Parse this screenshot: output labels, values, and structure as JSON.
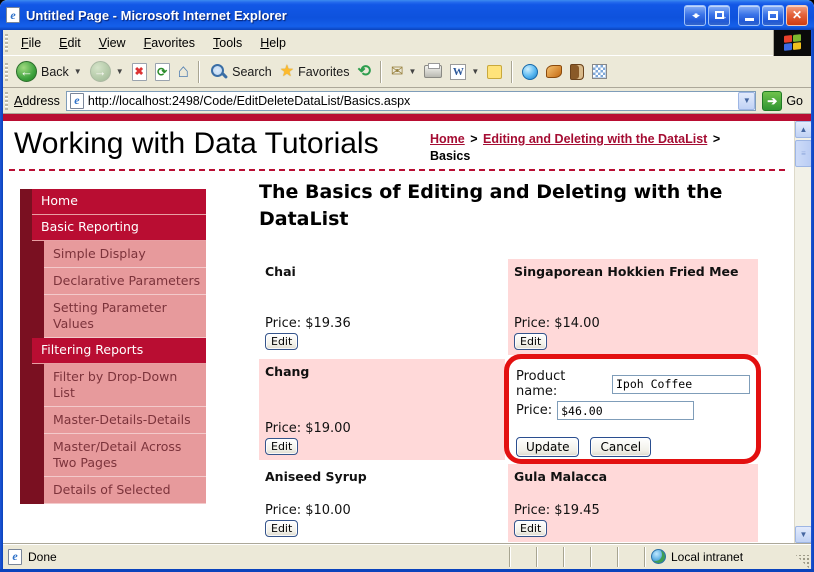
{
  "window": {
    "title": "Untitled Page - Microsoft Internet Explorer"
  },
  "menu": {
    "items": [
      "File",
      "Edit",
      "View",
      "Favorites",
      "Tools",
      "Help"
    ]
  },
  "toolbar": {
    "back_label": "Back",
    "search_label": "Search",
    "favorites_label": "Favorites",
    "icons": [
      "back",
      "forward",
      "stop",
      "refresh",
      "home",
      "search",
      "favorites",
      "history",
      "mail",
      "print",
      "edit-with-word",
      "notes",
      "messenger",
      "snagit",
      "research",
      "icq"
    ]
  },
  "address": {
    "label": "Address",
    "url": "http://localhost:2498/Code/EditDeleteDataList/Basics.aspx",
    "go_label": "Go"
  },
  "page": {
    "site_title": "Working with Data Tutorials",
    "breadcrumb": {
      "home": "Home",
      "separator": ">",
      "section": "Editing and Deleting with the DataList",
      "current": "Basics"
    }
  },
  "sidebar": {
    "items": [
      {
        "label": "Home",
        "level": 1
      },
      {
        "label": "Basic Reporting",
        "level": 1
      },
      {
        "label": "Simple Display",
        "level": 2
      },
      {
        "label": "Declarative Parameters",
        "level": 2
      },
      {
        "label": "Setting Parameter Values",
        "level": 2
      },
      {
        "label": "Filtering Reports",
        "level": 1
      },
      {
        "label": "Filter by Drop-Down List",
        "level": 2
      },
      {
        "label": "Master-Details-Details",
        "level": 2
      },
      {
        "label": "Master/Detail Across Two Pages",
        "level": 2
      },
      {
        "label": "Details of Selected",
        "level": 2
      }
    ]
  },
  "main": {
    "heading": "The Basics of Editing and Deleting with the DataList",
    "products": [
      {
        "name": "Chai",
        "price": "Price: $19.36",
        "edit_label": "Edit",
        "highlighted": false
      },
      {
        "name": "Singaporean Hokkien Fried Mee",
        "price": "Price: $14.00",
        "edit_label": "Edit",
        "highlighted": true
      },
      {
        "name": "Chang",
        "price": "Price: $19.00",
        "edit_label": "Edit",
        "highlighted": true
      },
      {
        "name": "Aniseed Syrup",
        "price": "Price: $10.00",
        "edit_label": "Edit",
        "highlighted": false
      },
      {
        "name": "Gula Malacca",
        "price": "Price: $19.45",
        "edit_label": "Edit",
        "highlighted": true
      }
    ],
    "edit_form": {
      "product_name_label": "Product name:",
      "product_name_value": "Ipoh Coffee",
      "price_label": "Price:",
      "price_value": "$46.00",
      "update_label": "Update",
      "cancel_label": "Cancel"
    }
  },
  "statusbar": {
    "status": "Done",
    "zone": "Local intranet"
  },
  "colors": {
    "titlebar_blue": "#1257E6",
    "chrome_tan": "#ECE9D8",
    "crimson": "#B90D32",
    "dark_maroon": "#7A1021",
    "sidebar_pink": "#E79A9C",
    "item_pink": "#FFD9D9",
    "annotation_red": "#E31010",
    "link_maroon": "#A50D33"
  }
}
